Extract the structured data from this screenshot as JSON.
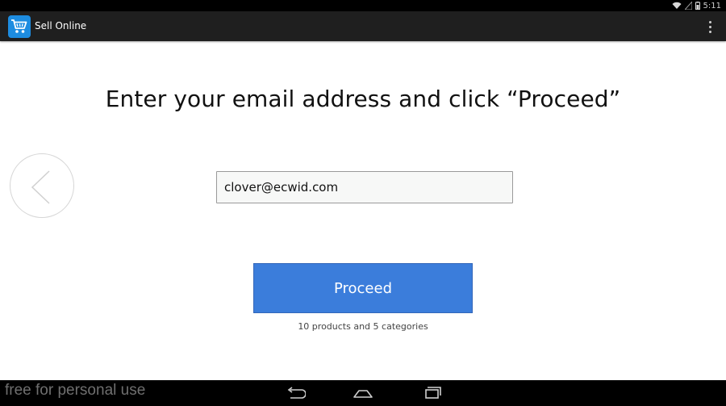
{
  "status_bar": {
    "time": "5:11",
    "icons": [
      "wifi-icon",
      "signal-icon",
      "battery-icon"
    ]
  },
  "action_bar": {
    "app_icon": "shopping-cart-icon",
    "title": "Sell Online",
    "menu_icon": "overflow-menu-icon"
  },
  "main": {
    "heading": "Enter your email address and click “Proceed”",
    "back_icon": "chevron-left-icon",
    "email": {
      "value": "clover@ecwid.com",
      "placeholder": ""
    },
    "proceed_label": "Proceed",
    "summary": "10 products and 5 categories"
  },
  "nav_bar": {
    "watermark": "free for personal use",
    "buttons": [
      "back-nav-icon",
      "home-nav-icon",
      "recents-nav-icon"
    ]
  },
  "colors": {
    "action_bar": "#1f1f1f",
    "app_icon": "#1d8ce0",
    "proceed_button": "#3b7ddb",
    "input_bg": "#f7f8f7"
  }
}
